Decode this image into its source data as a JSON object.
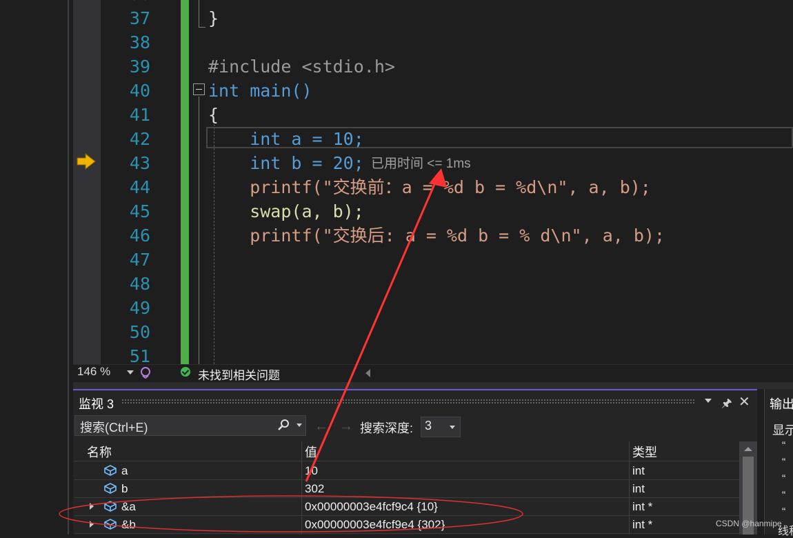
{
  "editor": {
    "lines": [
      {
        "num": "37",
        "code": "}"
      },
      {
        "num": "38",
        "code": ""
      },
      {
        "num": "39",
        "code": "#include <stdio.h>"
      },
      {
        "num": "40",
        "code": "int main()"
      },
      {
        "num": "41",
        "code": "{"
      },
      {
        "num": "42",
        "code": "    int a = 10;"
      },
      {
        "num": "43",
        "code": "    int b = 20;"
      },
      {
        "num": "44",
        "code": "    printf(\"交换前：a = %d b = %d\\n\", a, b);"
      },
      {
        "num": "45",
        "code": "    swap(a, b);"
      },
      {
        "num": "46",
        "code": "    printf(\"交换后: a = %d b = % d\\n\", a, b);"
      },
      {
        "num": "47",
        "code": ""
      },
      {
        "num": "48",
        "code": ""
      },
      {
        "num": "49",
        "code": ""
      },
      {
        "num": "50",
        "code": ""
      },
      {
        "num": "51",
        "code": ""
      }
    ],
    "perf_tip": "已用时间 <= 1ms",
    "current_line": "43",
    "colors": {
      "keyword": "#569cd6",
      "string": "#d69d85",
      "number": "#b5cea8",
      "function": "#dcdcaa",
      "variable": "#9cdcfe",
      "line_number": "#2b91af",
      "change_bar": "#4fae4a"
    }
  },
  "status": {
    "zoom": "146 %",
    "issues": "未找到相关问题"
  },
  "watch": {
    "title": "监视 3",
    "search_placeholder": "搜索(Ctrl+E)",
    "depth_label": "搜索深度:",
    "depth_value": "3",
    "columns": [
      "名称",
      "值",
      "类型"
    ],
    "rows": [
      {
        "name": "a",
        "value": "10",
        "type": "int",
        "expandable": false
      },
      {
        "name": "b",
        "value": "302",
        "type": "int",
        "expandable": false
      },
      {
        "name": "&a",
        "value": "0x00000003e4fcf9c4 {10}",
        "type": "int *",
        "expandable": true
      },
      {
        "name": "&b",
        "value": "0x00000003e4fcf9e4 {302}",
        "type": "int *",
        "expandable": true
      }
    ]
  },
  "output": {
    "title": "输出",
    "show_label": "显示",
    "lines": [
      "“",
      "“",
      "“",
      "“",
      "“"
    ],
    "tail": "线程"
  },
  "watermark": "CSDN @hanmipe"
}
